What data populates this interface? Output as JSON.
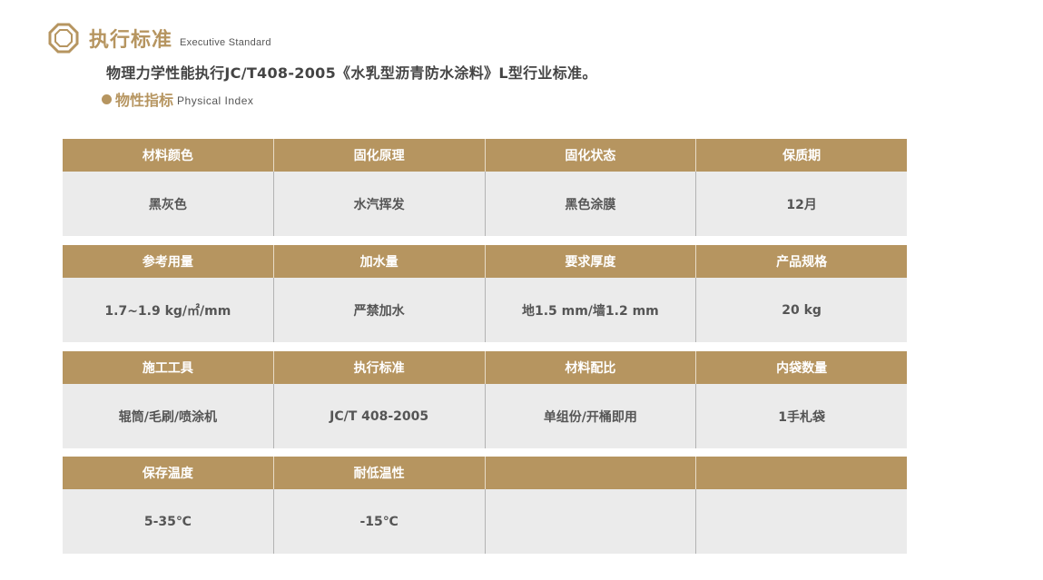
{
  "header": {
    "title_cn": "执行标准",
    "title_en": "Executive Standard",
    "icon": "octagon-ring-icon"
  },
  "intro_text": "物理力学性能执行JC/T408-2005《水乳型沥青防水涂料》L型行业标准。",
  "subheading": {
    "title_cn": "物性指标",
    "title_en": "Physical  Index"
  },
  "colors": {
    "accent": "#b69560",
    "cell_bg": "#ebebeb",
    "text": "#555555"
  },
  "tables": [
    {
      "headers": [
        "材料颜色",
        "固化原理",
        "固化状态",
        "保质期"
      ],
      "values": [
        "黑灰色",
        "水汽挥发",
        "黑色涂膜",
        "12月"
      ]
    },
    {
      "headers": [
        "参考用量",
        "加水量",
        "要求厚度",
        "产品规格"
      ],
      "values": [
        "1.7~1.9 kg/㎡/mm",
        "严禁加水",
        "地1.5 mm/墙1.2 mm",
        "20 kg"
      ]
    },
    {
      "headers": [
        "施工工具",
        "执行标准",
        "材料配比",
        "内袋数量"
      ],
      "values": [
        "辊筒/毛刷/喷涂机",
        "JC/T 408-2005",
        "单组份/开桶即用",
        "1手札袋"
      ]
    },
    {
      "headers": [
        "保存温度",
        "耐低温性",
        "",
        ""
      ],
      "values": [
        "5-35℃",
        "-15℃",
        "",
        ""
      ]
    }
  ]
}
